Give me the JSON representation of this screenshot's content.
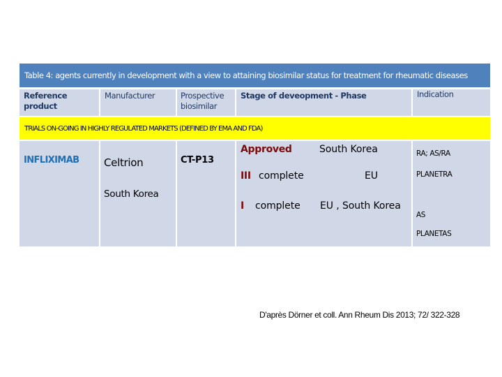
{
  "table": {
    "title": "Table 4: agents currently in development with a view to attaining  biosimilar status for treatment for rheumatic diseases",
    "headers": {
      "reference_product": "Reference product",
      "manufacturer": "Manufacturer",
      "prospective_biosimilar_line1": "Prospective",
      "prospective_biosimilar_line2": "biosimilar",
      "stage": "Stage of deveopment  - Phase",
      "indication": "Indication"
    },
    "section_banner": "TRIALS ON-GOING IN HIGHLY REGULATED MARKETS (DEFINED BY EMA AND FDA)",
    "rows": [
      {
        "reference_product": "INFLIXIMAB",
        "manufacturer": "Celtrion",
        "manufacturer_country": "South Korea",
        "prospective_biosimilar": "CT-P13",
        "stages": [
          {
            "phase": "Approved",
            "status": "",
            "region": "South Korea"
          },
          {
            "phase": "III",
            "status": "complete",
            "region": "EU"
          },
          {
            "phase": "I",
            "status": "complete",
            "region": "EU , South Korea"
          }
        ],
        "indications": [
          "RA; AS/RA",
          "PLANETRA",
          "AS",
          "PLANETAS"
        ]
      }
    ],
    "colors": {
      "title_bg": "#4f81bd",
      "cell_bg": "#d0d8e8",
      "banner_bg": "#ffff00",
      "header_text": "#1f3864",
      "reference_text": "#1f6fb4",
      "phase_text": "#7b0a0a"
    }
  },
  "citation": "D'après Dörner et coll. Ann Rheum Dis 2013; 72/ 322-328"
}
